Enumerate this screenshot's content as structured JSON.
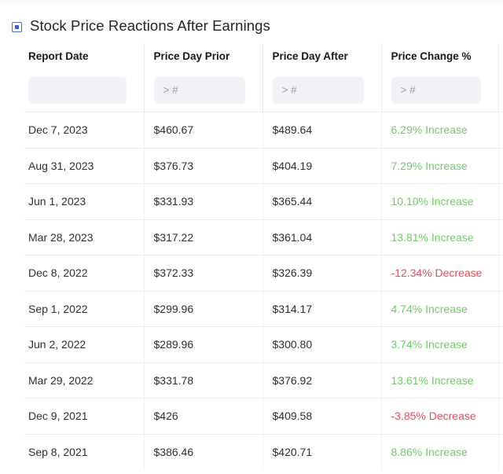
{
  "title": {
    "icon": "stop-square-icon",
    "text": "Stock Price Reactions After Earnings"
  },
  "colors": {
    "increase": "#74c86b",
    "decrease": "#eb4b52",
    "accent": "#3a5bd0",
    "header_text": "#16181d",
    "body_text": "#2b2f36",
    "filter_bg": "#f1f2f7",
    "divider": "#e9ebef"
  },
  "table": {
    "columns": [
      {
        "key": "report_date",
        "label": "Report Date",
        "filter_value": "",
        "filter_placeholder": ""
      },
      {
        "key": "price_prior",
        "label": "Price Day Prior",
        "filter_value": "",
        "filter_placeholder": "> #"
      },
      {
        "key": "price_after",
        "label": "Price Day After",
        "filter_value": "",
        "filter_placeholder": "> #"
      },
      {
        "key": "price_change",
        "label": "Price Change %",
        "filter_value": "",
        "filter_placeholder": "> #"
      }
    ],
    "rows": [
      {
        "report_date": "Dec 7, 2023",
        "price_prior": "$460.67",
        "price_after": "$489.64",
        "price_change": "6.29% Increase",
        "direction": "up"
      },
      {
        "report_date": "Aug 31, 2023",
        "price_prior": "$376.73",
        "price_after": "$404.19",
        "price_change": "7.29% Increase",
        "direction": "up"
      },
      {
        "report_date": "Jun 1, 2023",
        "price_prior": "$331.93",
        "price_after": "$365.44",
        "price_change": "10.10% Increase",
        "direction": "up"
      },
      {
        "report_date": "Mar 28, 2023",
        "price_prior": "$317.22",
        "price_after": "$361.04",
        "price_change": "13.81% Increase",
        "direction": "up"
      },
      {
        "report_date": "Dec 8, 2022",
        "price_prior": "$372.33",
        "price_after": "$326.39",
        "price_change": "-12.34% Decrease",
        "direction": "down"
      },
      {
        "report_date": "Sep 1, 2022",
        "price_prior": "$299.96",
        "price_after": "$314.17",
        "price_change": "4.74% Increase",
        "direction": "up"
      },
      {
        "report_date": "Jun 2, 2022",
        "price_prior": "$289.96",
        "price_after": "$300.80",
        "price_change": "3.74% Increase",
        "direction": "up"
      },
      {
        "report_date": "Mar 29, 2022",
        "price_prior": "$331.78",
        "price_after": "$376.92",
        "price_change": "13.61% Increase",
        "direction": "up"
      },
      {
        "report_date": "Dec 9, 2021",
        "price_prior": "$426",
        "price_after": "$409.58",
        "price_change": "-3.85% Decrease",
        "direction": "down"
      },
      {
        "report_date": "Sep 8, 2021",
        "price_prior": "$386.46",
        "price_after": "$420.71",
        "price_change": "8.86% Increase",
        "direction": "up"
      }
    ]
  }
}
